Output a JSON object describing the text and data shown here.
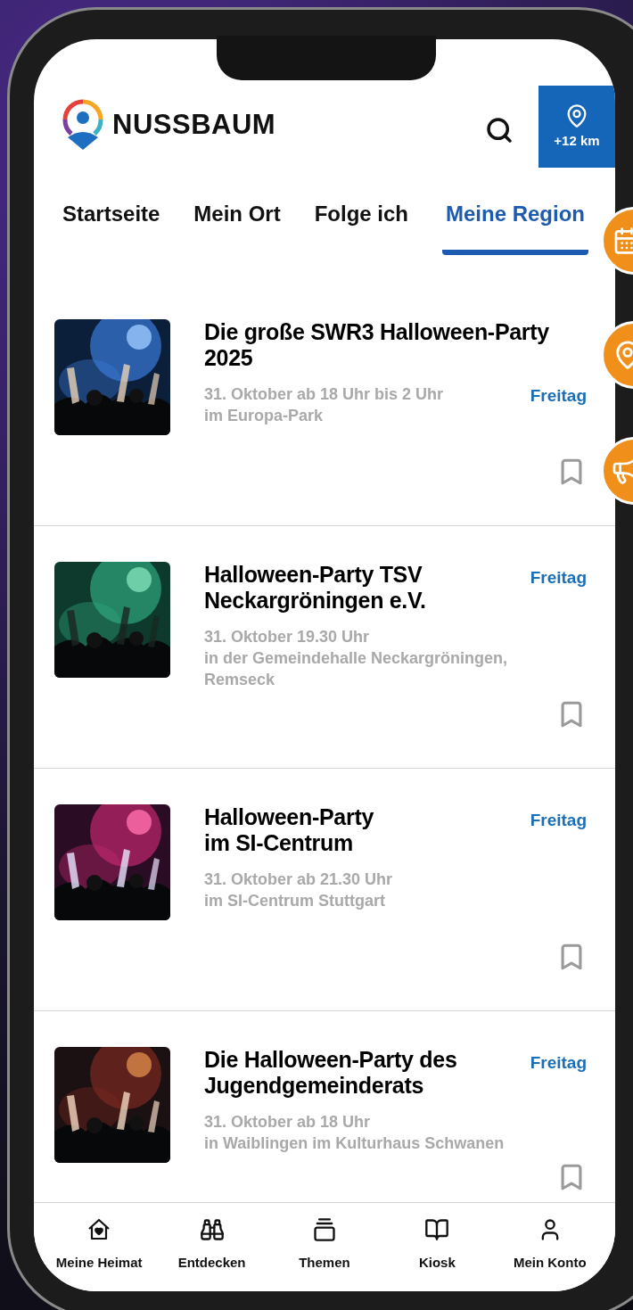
{
  "header": {
    "brand": "NUSSBAUM",
    "radius_button": "+12 km"
  },
  "tabs": [
    {
      "label": "Startseite",
      "selected": false
    },
    {
      "label": "Mein Ort",
      "selected": false
    },
    {
      "label": "Folge ich",
      "selected": false
    },
    {
      "label": "Meine Region",
      "selected": true
    }
  ],
  "events": [
    {
      "title": "Die große SWR3 Halloween-Party 2025",
      "date": "31. Oktober ab 18 Uhr bis 2 Uhr",
      "place": "im Europa-Park",
      "day": "Freitag",
      "kind": "long_title",
      "bookmarked": false
    },
    {
      "title": "Halloween-Party TSV Neckargröningen e.V.",
      "date": "31. Oktober 19.30 Uhr",
      "place": "in der Gemeindehalle Neckargröningen, Remseck",
      "day": "Freitag",
      "kind": "short_title",
      "bookmarked": false
    },
    {
      "title": "Halloween-Party\nim SI-Centrum",
      "date": "31. Oktober ab 21.30 Uhr",
      "place": "im SI-Centrum Stuttgart",
      "day": "Freitag",
      "kind": "short_title",
      "bookmarked": false
    },
    {
      "title": "Die Halloween-Party des Jugendgemeinderats",
      "date": "31. Oktober ab 18 Uhr",
      "place": "in Waiblingen im Kulturhaus Schwanen",
      "day": "Freitag",
      "kind": "short_title",
      "bookmarked": false
    }
  ],
  "bottom_nav": [
    {
      "label": "Meine Heimat"
    },
    {
      "label": "Entdecken"
    },
    {
      "label": "Themen"
    },
    {
      "label": "Kiosk"
    },
    {
      "label": "Mein Konto"
    }
  ]
}
